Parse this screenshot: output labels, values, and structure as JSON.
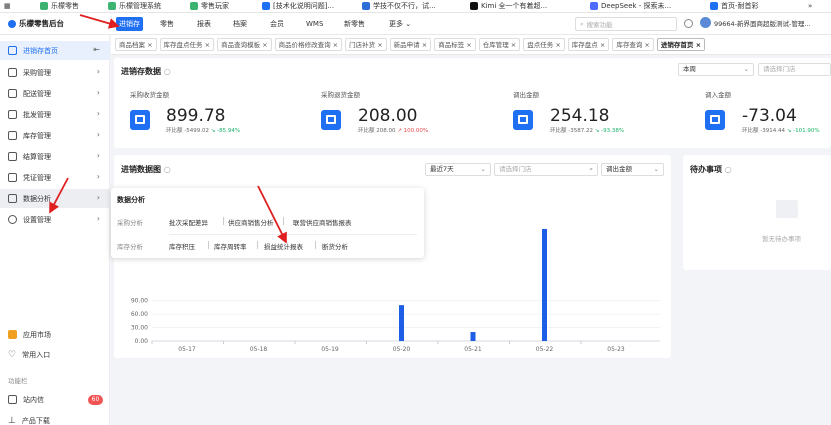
{
  "bookmarks": [
    {
      "label": "乐檬零售",
      "color": "#3cb371"
    },
    {
      "label": "乐檬管理系统",
      "color": "#3cb371"
    },
    {
      "label": "零售玩家",
      "color": "#3cb371"
    },
    {
      "label": "[技术化说明问题]...",
      "color": "#1e6ff1"
    },
    {
      "label": "学技不仅不行，试...",
      "color": "#2b6fd6"
    },
    {
      "label": "Kimi 全一个有着超...",
      "color": "#111111"
    },
    {
      "label": "DeepSeek - 探索未...",
      "color": "#4d6bfe"
    },
    {
      "label": "首页-耐首彩",
      "color": "#1e6ff1"
    }
  ],
  "header": {
    "brand": "乐檬零售后台",
    "nav": [
      "进销存",
      "零售",
      "报表",
      "档案",
      "会员",
      "WMS",
      "新零售",
      "更多"
    ],
    "search_placeholder": "搜索功能",
    "user": "99664-新界面商超版测试-管理..."
  },
  "sidebar": {
    "items": [
      {
        "label": "进销存首页",
        "icon": "home-icon"
      },
      {
        "label": "采购管理",
        "icon": "cart-icon"
      },
      {
        "label": "配送管理",
        "icon": "truck-icon"
      },
      {
        "label": "批发管理",
        "icon": "wholesale-icon"
      },
      {
        "label": "库存管理",
        "icon": "inventory-icon"
      },
      {
        "label": "结算管理",
        "icon": "settle-icon"
      },
      {
        "label": "凭证管理",
        "icon": "voucher-icon"
      },
      {
        "label": "数据分析",
        "icon": "chart-icon"
      },
      {
        "label": "设置管理",
        "icon": "settings-icon"
      }
    ],
    "bottom": [
      {
        "label": "应用市场",
        "icon": "app-market-icon"
      },
      {
        "label": "常用入口",
        "icon": "heart-icon"
      }
    ],
    "section_label": "功能栏",
    "mail_label": "站内信",
    "mail_badge": "60",
    "download_label": "产品下载"
  },
  "tabs": [
    "商品档案",
    "库存盘点任务",
    "商品查询模板",
    "商品价格修改查询",
    "门店补货",
    "新品申请",
    "商品标签",
    "仓库管理",
    "盘点任务",
    "库存盘点",
    "库存查询",
    "进销存首页"
  ],
  "inventory": {
    "title": "进销存数据",
    "period": "本周",
    "store_placeholder": "请选择门店",
    "stats": [
      {
        "label": "采购收货金额",
        "value": "899.78",
        "compare": "环比额 -5499.02",
        "pct": "-85.94%"
      },
      {
        "label": "采购退货金额",
        "value": "208.00",
        "compare": "环比额 208.00",
        "pct": "100.00%"
      },
      {
        "label": "调出金额",
        "value": "254.18",
        "compare": "环比额 -3587.22",
        "pct": "-93.38%"
      },
      {
        "label": "调入金额",
        "value": "-73.04",
        "compare": "环比额 -3914.44",
        "pct": "-101.90%"
      }
    ]
  },
  "chart_panel": {
    "title": "进销数据图",
    "range": "最近7天",
    "store_placeholder": "请选择门店",
    "metric": "调出金额"
  },
  "chart_data": {
    "type": "bar",
    "categories": [
      "05-17",
      "05-18",
      "05-19",
      "05-20",
      "05-21",
      "05-22",
      "05-23"
    ],
    "values": [
      0,
      0,
      0,
      80,
      20,
      250,
      0
    ],
    "y_ticks": [
      "0.00",
      "30.00",
      "60.00",
      "90.00"
    ],
    "ylim": [
      0,
      270
    ],
    "color": "#1e5de6"
  },
  "todo": {
    "title": "待办事项",
    "empty_text": "暂无待办事项"
  },
  "popup": {
    "title": "数据分析",
    "groups": [
      {
        "label": "采购分析",
        "links": [
          "批次采配差异",
          "供应商销售分析",
          "联营供应商销售报表"
        ]
      },
      {
        "label": "库存分析",
        "links": [
          "库存积压",
          "库存周转率",
          "损益统计报表",
          "断货分析"
        ]
      }
    ]
  }
}
